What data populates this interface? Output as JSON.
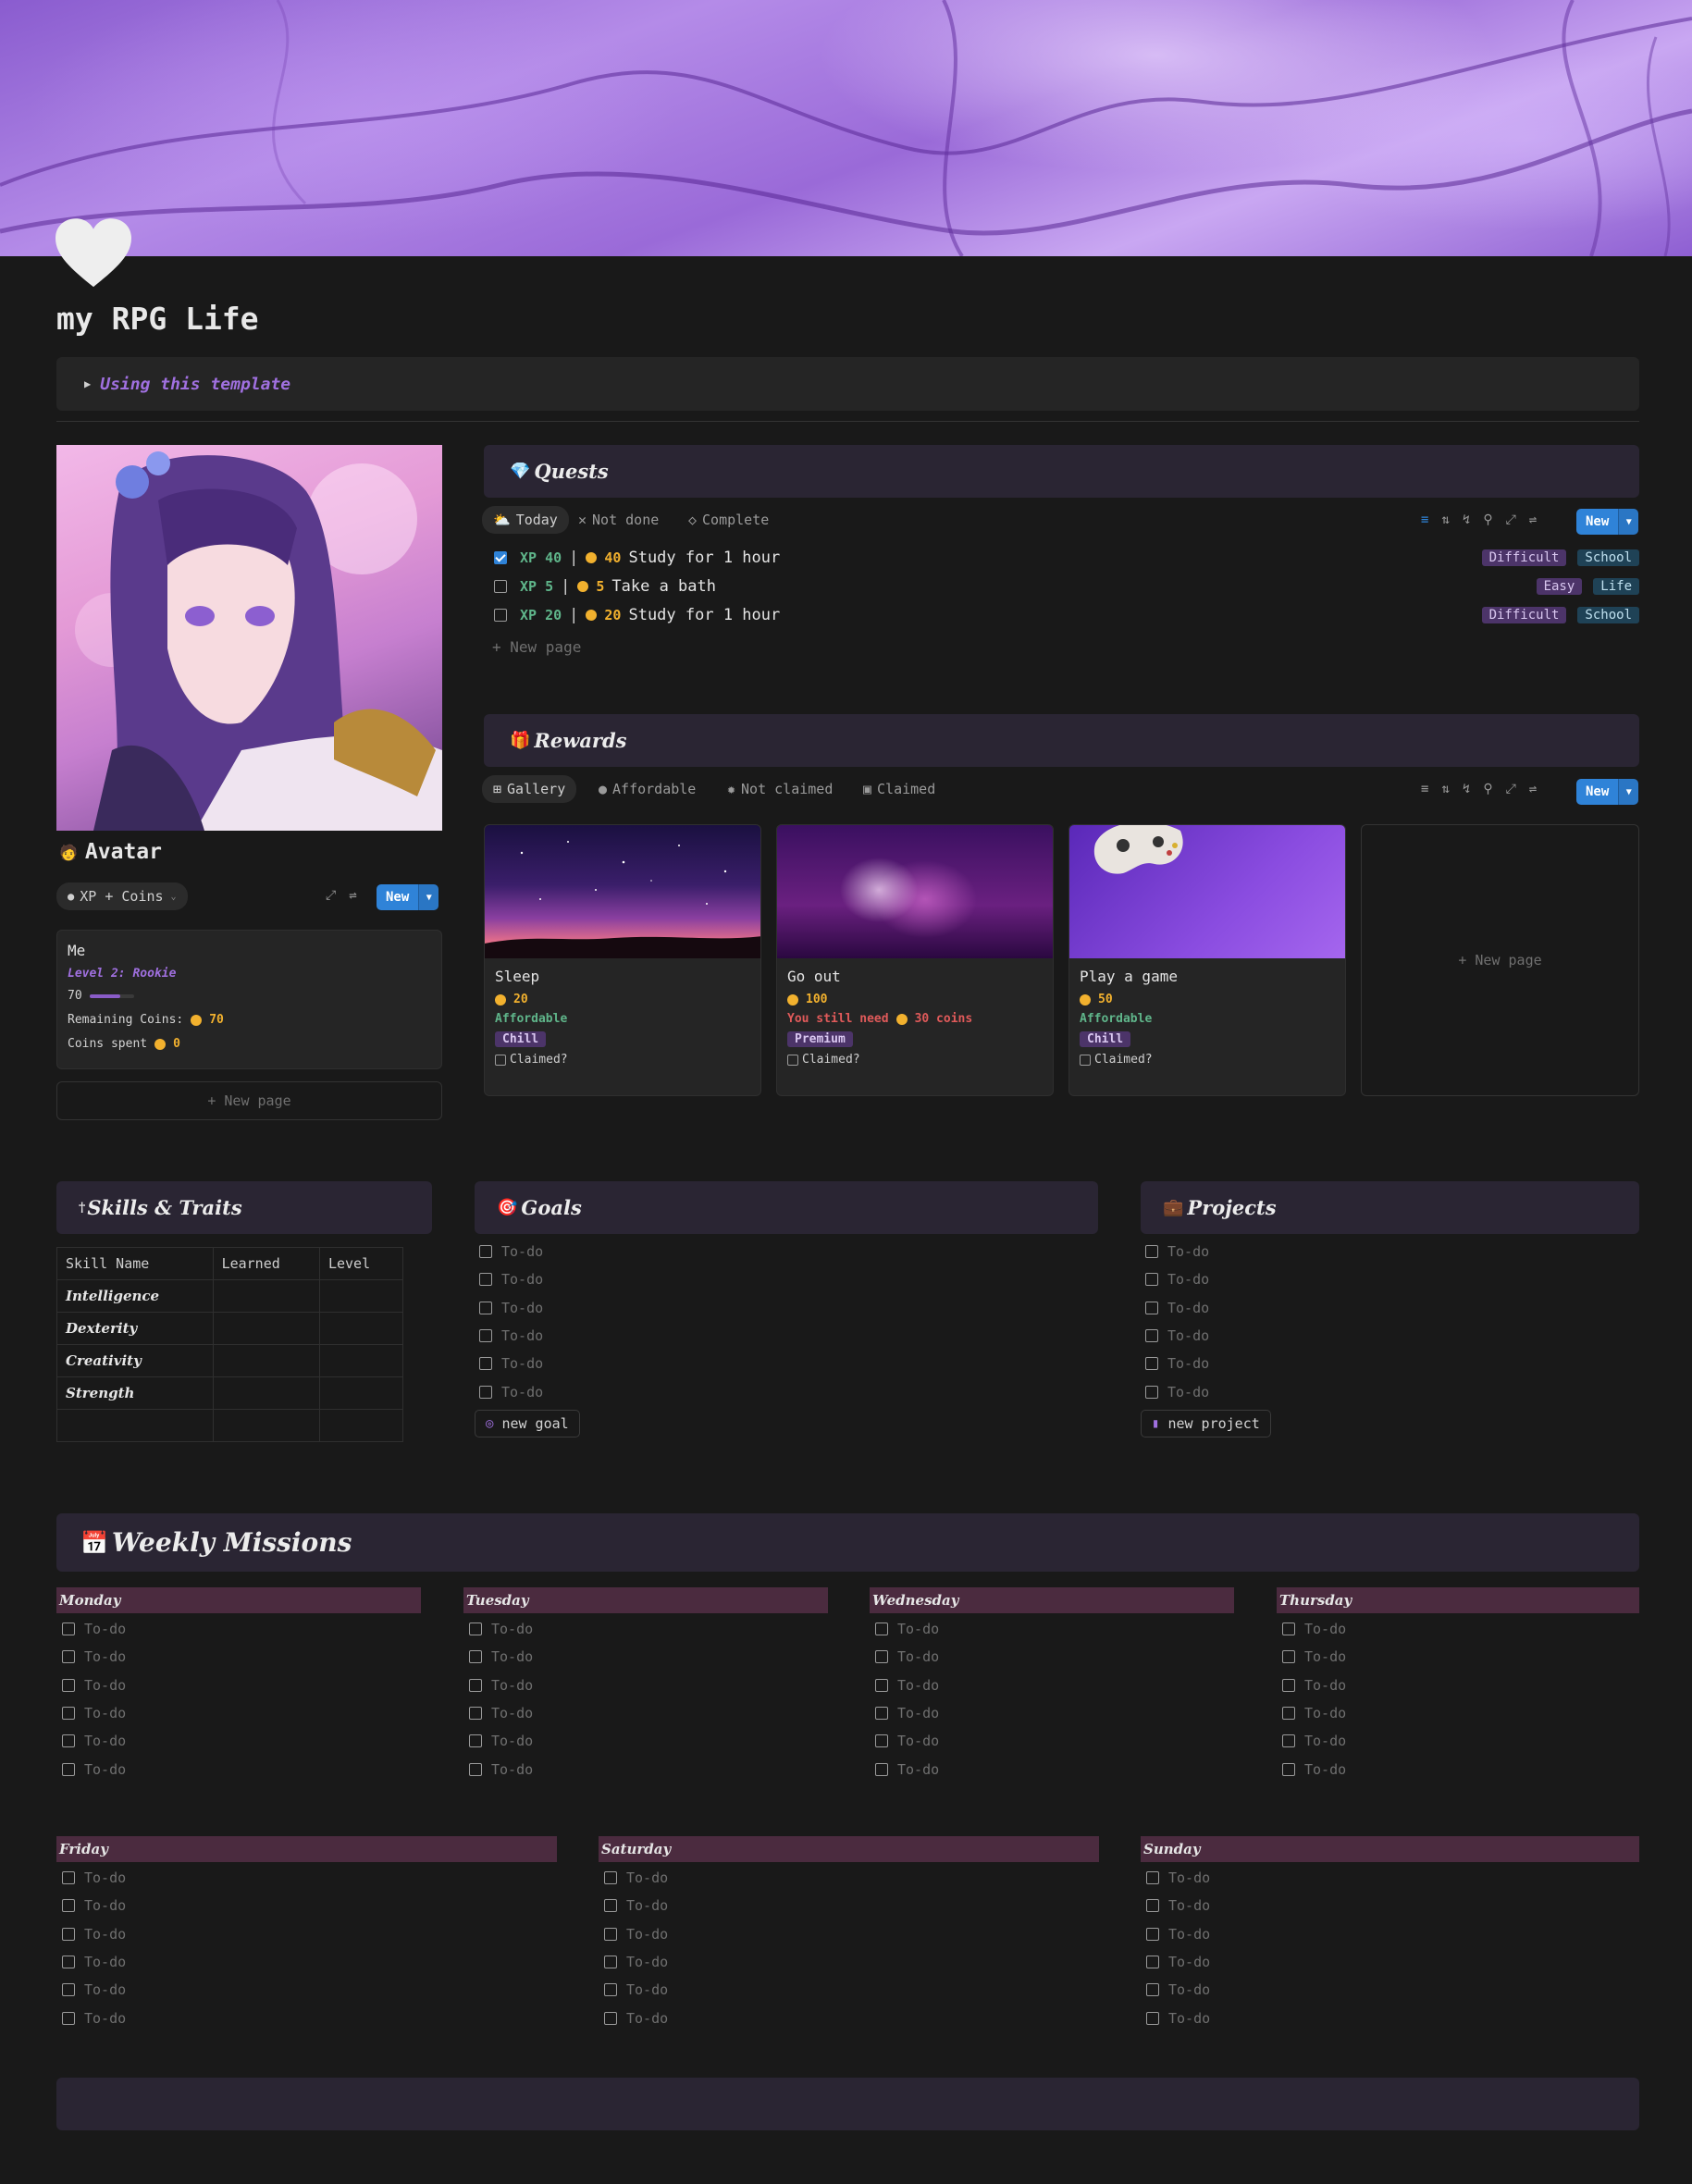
{
  "page": {
    "title": "my RPG Life",
    "toggle_text": "Using this template"
  },
  "avatar": {
    "title": "Avatar",
    "view_chip": "XP + Coins",
    "new_label": "New",
    "card": {
      "name": "Me",
      "level": "Level 2: Rookie",
      "xp_value": "70",
      "xp_progress": 0.7,
      "remaining_label": "Remaining Coins:",
      "remaining_value": "70",
      "spent_label": "Coins spent",
      "spent_value": "0"
    },
    "new_page": "+ New page"
  },
  "quests": {
    "title": "Quests",
    "tabs": [
      "Today",
      "Not done",
      "Complete"
    ],
    "new_label": "New",
    "rows": [
      {
        "checked": true,
        "xp": "XP 40",
        "sep": "|",
        "coins": "40",
        "name": "Study for 1 hour",
        "difficulty": "Difficult",
        "category": "School"
      },
      {
        "checked": false,
        "xp": "XP 5",
        "sep": "|",
        "coins": "5",
        "name": "Take a bath",
        "difficulty": "Easy",
        "category": "Life"
      },
      {
        "checked": false,
        "xp": "XP 20",
        "sep": "|",
        "coins": "20",
        "name": "Study for 1 hour",
        "difficulty": "Difficult",
        "category": "School"
      }
    ],
    "new_page": "+ New page"
  },
  "rewards": {
    "title": "Rewards",
    "tabs": [
      "Gallery",
      "Affordable",
      "Not claimed",
      "Claimed"
    ],
    "new_label": "New",
    "cards": [
      {
        "name": "Sleep",
        "cost": "20",
        "status": "Affordable",
        "status_color": "#5fb58a",
        "tag": "Chill",
        "claimed_label": "Claimed?"
      },
      {
        "name": "Go out",
        "cost": "100",
        "status_prefix": "You still need",
        "status_coins": "30 coins",
        "status_color": "#e05a5a",
        "tag": "Premium",
        "claimed_label": "Claimed?"
      },
      {
        "name": "Play a game",
        "cost": "50",
        "status": "Affordable",
        "status_color": "#5fb58a",
        "tag": "Chill",
        "claimed_label": "Claimed?"
      }
    ],
    "new_page": "+ New page"
  },
  "skills": {
    "title": "Skills & Traits",
    "columns": [
      "Skill Name",
      "Learned",
      "Level"
    ],
    "rows": [
      "Intelligence",
      "Dexterity",
      "Creativity",
      "Strength"
    ]
  },
  "goals": {
    "title": "Goals",
    "todo": "To-do",
    "button": "new goal"
  },
  "projects": {
    "title": "Projects",
    "todo": "To-do",
    "button": "new project"
  },
  "weekly": {
    "title": "Weekly Missions",
    "todo": "To-do",
    "days": [
      "Monday",
      "Tuesday",
      "Wednesday",
      "Thursday",
      "Friday",
      "Saturday",
      "Sunday"
    ]
  },
  "colors": {
    "accent": "#2f83d8",
    "heading_bg": "#2a2533",
    "day_bg": "#4b2b3f",
    "coin": "#f2b12e",
    "xp": "#5fb58a"
  }
}
